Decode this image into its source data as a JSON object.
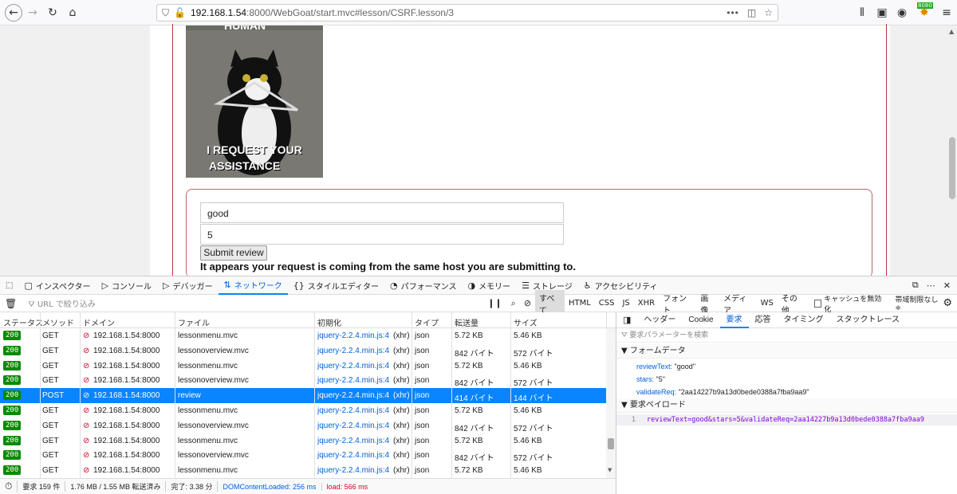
{
  "browser": {
    "url_host": "192.168.1.54",
    "url_path": ":8000/WebGoat/start.mvc#lesson/CSRF.lesson/3",
    "ext_badge": "8080"
  },
  "page": {
    "meme_top_text": "HUMAN",
    "meme_caption_line1": "I REQUEST YOUR",
    "meme_caption_line2": "ASSISTANCE",
    "review_value": "good",
    "stars_value": "5",
    "submit_label": "Submit review",
    "feedback": "It appears your request is coming from the same host you are submitting to."
  },
  "devtools": {
    "tabs": [
      "インスペクター",
      "コンソール",
      "デバッガー",
      "ネットワーク",
      "スタイルエディター",
      "パフォーマンス",
      "メモリー",
      "ストレージ",
      "アクセシビリティ"
    ],
    "filter_placeholder": "URL で絞り込み",
    "type_filters": [
      "すべて",
      "HTML",
      "CSS",
      "JS",
      "XHR",
      "フォント",
      "画像",
      "メディア",
      "WS",
      "その他"
    ],
    "cache_label": "キャッシュを無効化",
    "throttle_label": "帯域制限なし ≑",
    "columns": [
      "ステータス",
      "メソッド",
      "ドメイン",
      "ファイル",
      "初期化",
      "タイプ",
      "転送量",
      "サイズ"
    ],
    "rows": [
      {
        "status": "200",
        "method": "GET",
        "domain": "192.168.1.54:8000",
        "file": "lessonmenu.mvc",
        "initiator": "jquery-2.2.4.min.js:4",
        "cause": "(xhr)",
        "type": "json",
        "transferred": "5.72 KB",
        "size": "5.46 KB"
      },
      {
        "status": "200",
        "method": "GET",
        "domain": "192.168.1.54:8000",
        "file": "lessonoverview.mvc",
        "initiator": "jquery-2.2.4.min.js:4",
        "cause": "(xhr)",
        "type": "json",
        "transferred": "842 バイト",
        "size": "572 バイト"
      },
      {
        "status": "200",
        "method": "GET",
        "domain": "192.168.1.54:8000",
        "file": "lessonmenu.mvc",
        "initiator": "jquery-2.2.4.min.js:4",
        "cause": "(xhr)",
        "type": "json",
        "transferred": "5.72 KB",
        "size": "5.46 KB"
      },
      {
        "status": "200",
        "method": "GET",
        "domain": "192.168.1.54:8000",
        "file": "lessonoverview.mvc",
        "initiator": "jquery-2.2.4.min.js:4",
        "cause": "(xhr)",
        "type": "json",
        "transferred": "842 バイト",
        "size": "572 バイト"
      },
      {
        "status": "200",
        "method": "POST",
        "domain": "192.168.1.54:8000",
        "file": "review",
        "initiator": "jquery-2.2.4.min.js:4",
        "cause": "(xhr)",
        "type": "json",
        "transferred": "414 バイト",
        "size": "144 バイト",
        "selected": true
      },
      {
        "status": "200",
        "method": "GET",
        "domain": "192.168.1.54:8000",
        "file": "lessonmenu.mvc",
        "initiator": "jquery-2.2.4.min.js:4",
        "cause": "(xhr)",
        "type": "json",
        "transferred": "5.72 KB",
        "size": "5.46 KB"
      },
      {
        "status": "200",
        "method": "GET",
        "domain": "192.168.1.54:8000",
        "file": "lessonoverview.mvc",
        "initiator": "jquery-2.2.4.min.js:4",
        "cause": "(xhr)",
        "type": "json",
        "transferred": "842 バイト",
        "size": "572 バイト"
      },
      {
        "status": "200",
        "method": "GET",
        "domain": "192.168.1.54:8000",
        "file": "lessonmenu.mvc",
        "initiator": "jquery-2.2.4.min.js:4",
        "cause": "(xhr)",
        "type": "json",
        "transferred": "5.72 KB",
        "size": "5.46 KB"
      },
      {
        "status": "200",
        "method": "GET",
        "domain": "192.168.1.54:8000",
        "file": "lessonoverview.mvc",
        "initiator": "jquery-2.2.4.min.js:4",
        "cause": "(xhr)",
        "type": "json",
        "transferred": "842 バイト",
        "size": "572 バイト"
      },
      {
        "status": "200",
        "method": "GET",
        "domain": "192.168.1.54:8000",
        "file": "lessonmenu.mvc",
        "initiator": "jquery-2.2.4.min.js:4",
        "cause": "(xhr)",
        "type": "json",
        "transferred": "5.72 KB",
        "size": "5.46 KB"
      }
    ],
    "statusbar": {
      "requests": "要求 159 件",
      "transfer": "1.76 MB / 1.55 MB 転送済み",
      "finish": "完了: 3.38 分",
      "dcl": "DOMContentLoaded: 256 ms",
      "load": "load: 566 ms"
    },
    "side": {
      "tabs": [
        "ヘッダー",
        "Cookie",
        "要求",
        "応答",
        "タイミング",
        "スタックトレース"
      ],
      "param_search_placeholder": "要求パラメーターを検索",
      "form_data_title": "フォームデータ",
      "form_data": [
        {
          "key": "reviewText:",
          "value": "\"good\""
        },
        {
          "key": "stars:",
          "value": "\"5\""
        },
        {
          "key": "validateReq:",
          "value": "\"2aa14227b9a13d0bede0388a7fba9aa9\""
        }
      ],
      "payload_title": "要求ペイロード",
      "payload_line_no": "1",
      "payload": "reviewText=good&stars=5&validateReq=2aa14227b9a13d0bede0388a7fba9aa9"
    },
    "colors": {
      "accent": "#0a84ff",
      "status_ok": "#058b00",
      "frame_red": "#b33333"
    }
  }
}
